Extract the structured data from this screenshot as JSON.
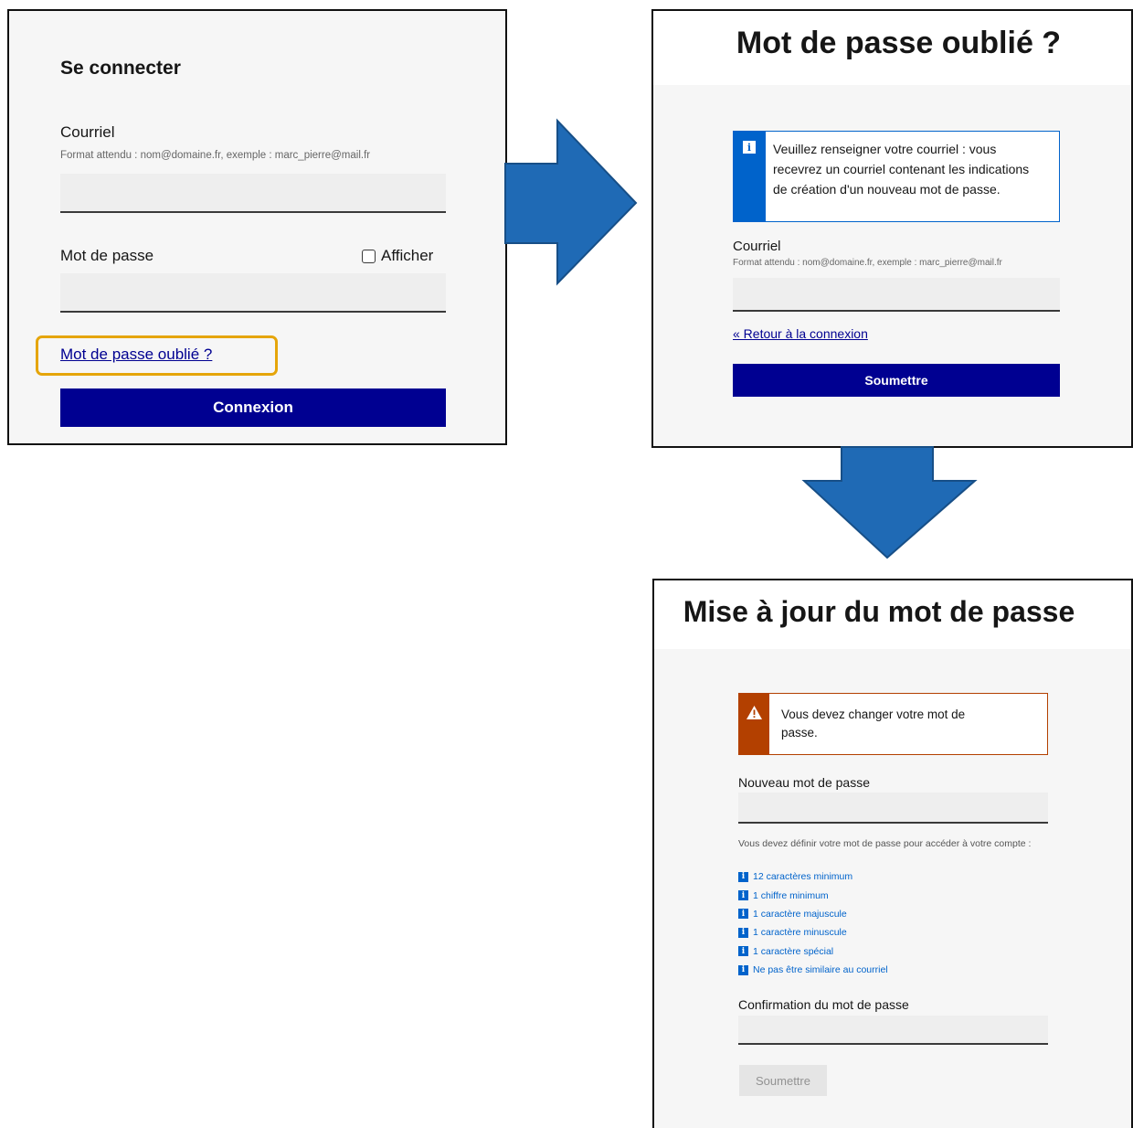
{
  "login": {
    "title": "Se connecter",
    "email_label": "Courriel",
    "email_hint": "Format attendu : nom@domaine.fr, exemple : marc_pierre@mail.fr",
    "password_label": "Mot de passe",
    "show_label": "Afficher",
    "forgot_link": "Mot de passe oublié ?",
    "submit": "Connexion"
  },
  "forgot": {
    "title": "Mot de passe oublié ?",
    "info": "Veuillez renseigner votre courriel : vous recevrez un courriel contenant les indications de création d'un nouveau mot de passe.",
    "email_label": "Courriel",
    "email_hint": "Format attendu : nom@domaine.fr, exemple : marc_pierre@mail.fr",
    "back_link": "« Retour à la connexion",
    "submit": "Soumettre"
  },
  "update": {
    "title": "Mise à jour du mot de passe",
    "warning": "Vous devez changer votre mot de passe.",
    "new_label": "Nouveau mot de passe",
    "intro": "Vous devez définir votre mot de passe pour accéder à votre compte :",
    "requirements": [
      "12 caractères minimum",
      "1 chiffre minimum",
      "1 caractère majuscule",
      "1 caractère minuscule",
      "1 caractère spécial",
      "Ne pas être similaire au courriel"
    ],
    "confirm_label": "Confirmation du mot de passe",
    "submit": "Soumettre"
  },
  "colors": {
    "primary_blue": "#000091",
    "highlight": "#e5a50a",
    "arrow_blue": "#1f6ab5",
    "warning": "#b34000",
    "info_blue": "#0063cb"
  }
}
